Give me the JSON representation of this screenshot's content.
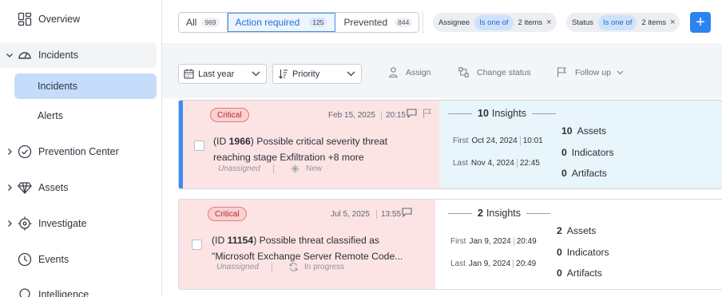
{
  "sidebar": {
    "items": [
      {
        "label": "Overview"
      },
      {
        "label": "Incidents"
      },
      {
        "label": "Prevention Center"
      },
      {
        "label": "Assets"
      },
      {
        "label": "Investigate"
      },
      {
        "label": "Events"
      },
      {
        "label": "Intelligence"
      }
    ],
    "sub_items": [
      {
        "label": "Incidents",
        "active": true
      },
      {
        "label": "Alerts",
        "active": false
      }
    ]
  },
  "tabs": [
    {
      "label": "All",
      "count": "969"
    },
    {
      "label": "Action required",
      "count": "125",
      "active": true
    },
    {
      "label": "Prevented",
      "count": "844"
    }
  ],
  "filters": [
    {
      "field": "Assignee",
      "operator": "Is one of",
      "value": "2 items"
    },
    {
      "field": "Status",
      "operator": "Is one of",
      "value": "2 items"
    }
  ],
  "add_label": "+",
  "toolbar": {
    "time_range": "Last year",
    "sort": "Priority",
    "assign": "Assign",
    "change_status": "Change status",
    "follow_up": "Follow up"
  },
  "incidents": [
    {
      "severity": "Critical",
      "date": "Feb 15, 2025",
      "time": "20:15",
      "id_prefix": "(ID ",
      "id": "1966",
      "title_rest": ") Possible critical severity threat",
      "title_line2": "reaching stage Exfiltration +8 more",
      "assignee": "Unassigned",
      "status": "New",
      "insights_count": "10",
      "insights_label": "Insights",
      "first_label": "First",
      "first_date": "Oct 24, 2024",
      "first_time": "10:01",
      "last_label": "Last",
      "last_date": "Nov 4, 2024",
      "last_time": "22:45",
      "assets_count": "10",
      "assets_label": "Assets",
      "indicators_count": "0",
      "indicators_label": "Indicators",
      "artifacts_count": "0",
      "artifacts_label": "Artifacts"
    },
    {
      "severity": "Critical",
      "date": "Jul 5, 2025",
      "time": "13:55",
      "id_prefix": "(ID ",
      "id": "11154",
      "title_rest": ") Possible threat classified as",
      "title_line2": "\"Microsoft Exchange Server Remote Code...",
      "assignee": "Unassigned",
      "status": "In progress",
      "insights_count": "2",
      "insights_label": "Insights",
      "first_label": "First",
      "first_date": "Jan 9, 2024",
      "first_time": "20:49",
      "last_label": "Last",
      "last_date": "Jan 9, 2024",
      "last_time": "20:49",
      "assets_count": "2",
      "assets_label": "Assets",
      "indicators_count": "0",
      "indicators_label": "Indicators",
      "artifacts_count": "0",
      "artifacts_label": "Artifacts"
    }
  ],
  "colors": {
    "accent": "#2d82f1",
    "critical_bg": "#fde4e4",
    "selected_right_bg": "#e8f5fb",
    "active_nav": "#c5ddfa"
  }
}
